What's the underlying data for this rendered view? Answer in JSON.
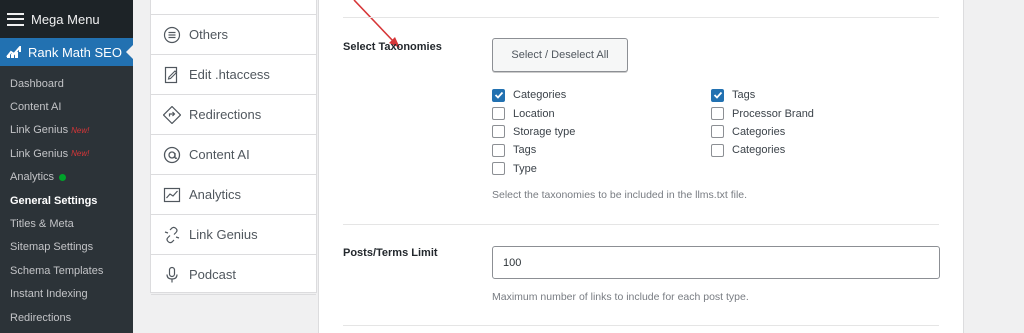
{
  "sidebar": {
    "mega_menu": "Mega Menu",
    "plugin": "Rank Math SEO",
    "items": [
      {
        "label": "Dashboard",
        "new": "",
        "dot": false,
        "active": false
      },
      {
        "label": "Content AI",
        "new": "",
        "dot": false,
        "active": false
      },
      {
        "label": "Link Genius",
        "new": "New!",
        "dot": false,
        "active": false
      },
      {
        "label": "Link Genius",
        "new": "New!",
        "dot": false,
        "active": false
      },
      {
        "label": "Analytics",
        "new": "",
        "dot": true,
        "active": false
      },
      {
        "label": "General Settings",
        "new": "",
        "dot": false,
        "active": true
      },
      {
        "label": "Titles & Meta",
        "new": "",
        "dot": false,
        "active": false
      },
      {
        "label": "Sitemap Settings",
        "new": "",
        "dot": false,
        "active": false
      },
      {
        "label": "Schema Templates",
        "new": "",
        "dot": false,
        "active": false
      },
      {
        "label": "Instant Indexing",
        "new": "",
        "dot": false,
        "active": false
      },
      {
        "label": "Redirections",
        "new": "",
        "dot": false,
        "active": false
      }
    ]
  },
  "settings_nav": {
    "items": [
      {
        "label": "Others",
        "icon": "list-circle-icon"
      },
      {
        "label": "Edit .htaccess",
        "icon": "file-edit-icon"
      },
      {
        "label": "Redirections",
        "icon": "redirect-icon"
      },
      {
        "label": "Content AI",
        "icon": "at-sign-icon"
      },
      {
        "label": "Analytics",
        "icon": "chart-line-icon"
      },
      {
        "label": "Link Genius",
        "icon": "link-broken-icon"
      },
      {
        "label": "Podcast",
        "icon": "microphone-icon"
      }
    ]
  },
  "taxonomies": {
    "label": "Select Taxonomies",
    "button": "Select / Deselect All",
    "left": [
      {
        "label": "Categories",
        "checked": true
      },
      {
        "label": "Location",
        "checked": false
      },
      {
        "label": "Storage type",
        "checked": false
      },
      {
        "label": "Tags",
        "checked": false
      },
      {
        "label": "Type",
        "checked": false
      }
    ],
    "right": [
      {
        "label": "Tags",
        "checked": true
      },
      {
        "label": "Processor Brand",
        "checked": false
      },
      {
        "label": "Categories",
        "checked": false
      },
      {
        "label": "Categories",
        "checked": false
      }
    ],
    "help": "Select the taxonomies to be included in the llms.txt file."
  },
  "limit": {
    "label": "Posts/Terms Limit",
    "value": "100",
    "help": "Maximum number of links to include for each post type."
  },
  "colors": {
    "accent": "#2271b1",
    "sidebar_bg": "#1d2327",
    "arrow": "#d63638"
  }
}
